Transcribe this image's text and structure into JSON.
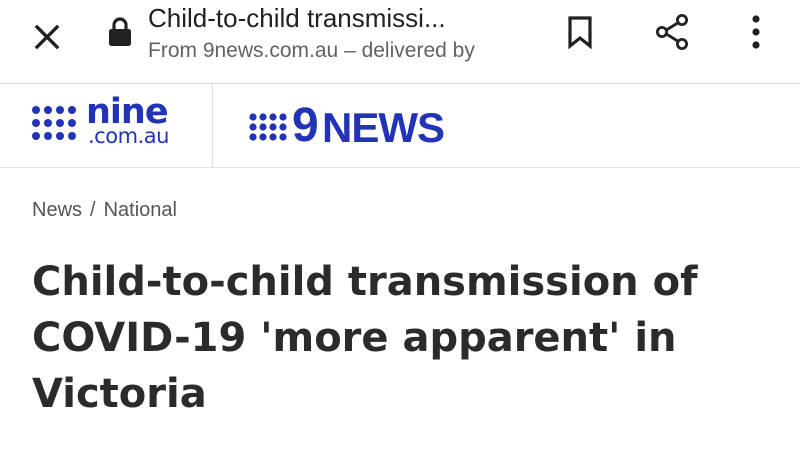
{
  "browser_bar": {
    "page_title": "Child-to-child transmissi...",
    "source_line": "From 9news.com.au – delivered by",
    "icons": {
      "close": "close-icon",
      "lock": "lock-icon",
      "bookmark": "bookmark-icon",
      "share": "share-icon",
      "menu": "more-vert-icon"
    }
  },
  "site_header": {
    "nine_logo": {
      "word": "nine",
      "domain": ".com.au"
    },
    "news_logo": {
      "numeral": "9",
      "word": "NEWS"
    },
    "brand_color": "#2233b8"
  },
  "breadcrumb": {
    "items": [
      "News",
      "National"
    ],
    "separator": "/"
  },
  "article": {
    "headline": "Child-to-child transmission of COVID-19 'more apparent' in Victoria"
  }
}
